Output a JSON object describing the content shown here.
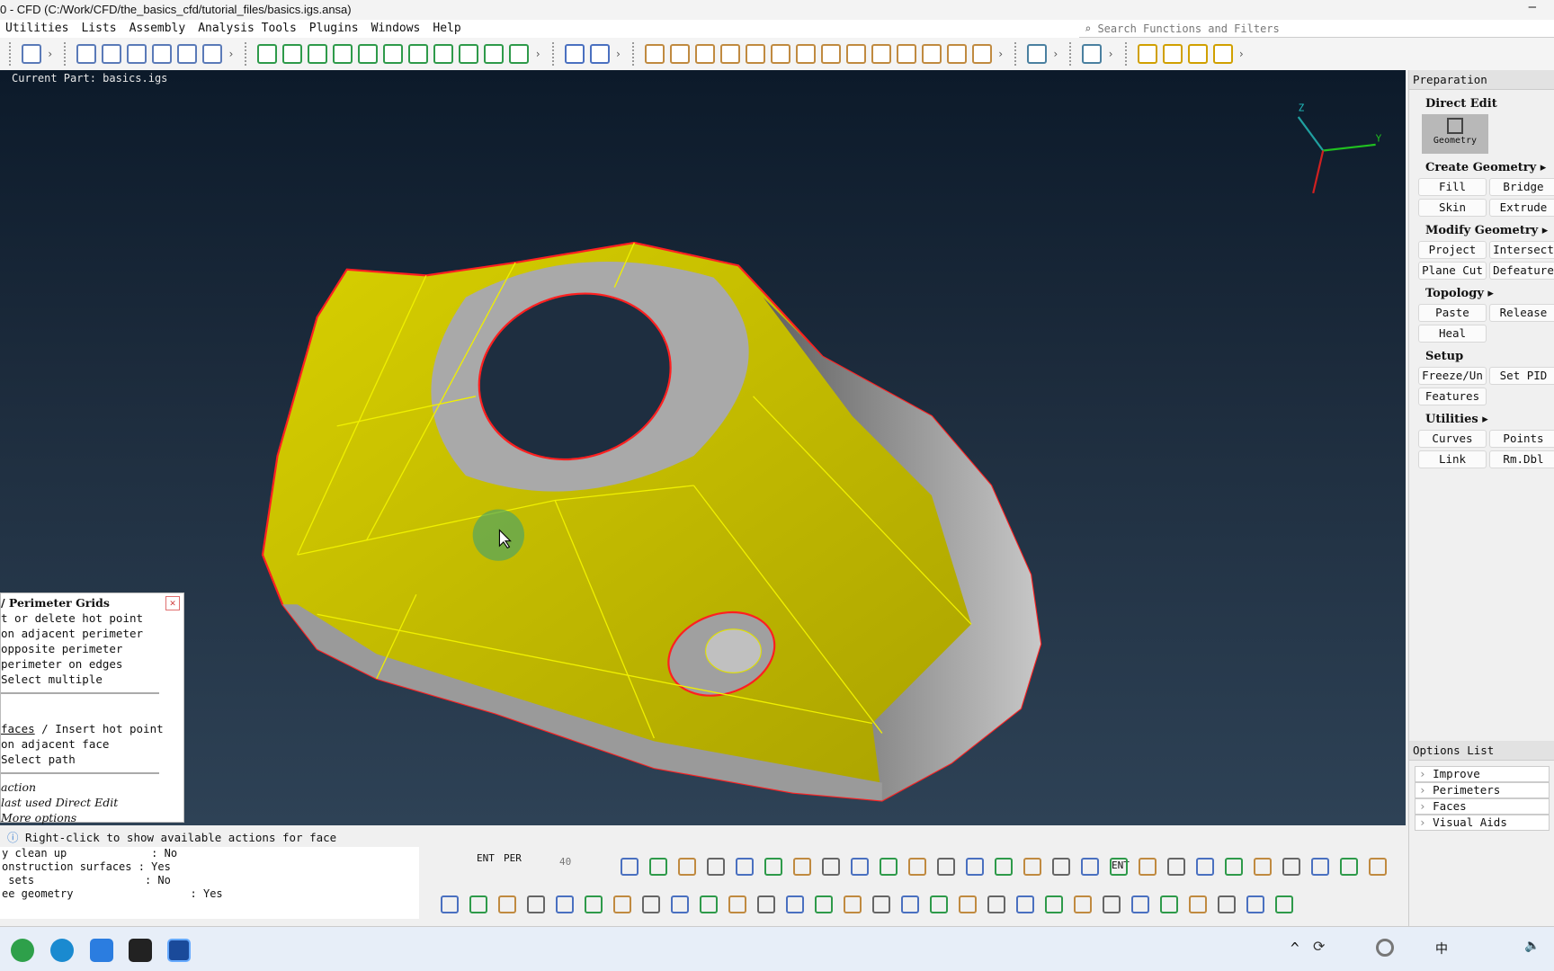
{
  "window": {
    "title": "0 - CFD (C:/Work/CFD/the_basics_cfd/tutorial_files/basics.igs.ansa)",
    "minimize": "–"
  },
  "menu": [
    "Utilities",
    "Lists",
    "Assembly",
    "Analysis Tools",
    "Plugins",
    "Windows",
    "Help"
  ],
  "search": {
    "placeholder": "Search Functions and Filters",
    "icon": "search-icon"
  },
  "viewport": {
    "current_part": "Current Part: basics.igs",
    "axis": {
      "z": "Z",
      "y": "Y"
    },
    "background": "#1c2b3c",
    "surface_color": "#c8c000",
    "edge_color": "#ff2020"
  },
  "popup": {
    "title": "/ Perimeter Grids",
    "lines": [
      "t or delete hot point",
      "on adjacent perimeter",
      " opposite perimeter",
      " perimeter on edges",
      "Select multiple"
    ],
    "faces_link": " faces",
    "faces_rest": " / Insert hot point",
    "lines2": [
      "on adjacent face",
      "Select path"
    ],
    "italic": [
      "action",
      " last used Direct Edit",
      " More options"
    ],
    "close": "✕"
  },
  "status": {
    "message": "Right-click to show available actions for face"
  },
  "console": [
    "y clean up             : No",
    "onstruction surfaces : Yes",
    " sets                 : No",
    "ee geometry                  : Yes"
  ],
  "bottom_toolbar": {
    "ent": "ENT",
    "per": "PER",
    "angle": "40",
    "ent2": "ENT"
  },
  "panel": {
    "header": "Preparation",
    "direct_edit": "Direct Edit",
    "geometry": "Geometry",
    "sections": [
      {
        "title": "Create Geometry ▸",
        "buttons": [
          "Fill",
          "Bridge",
          "Skin",
          "Extrude"
        ]
      },
      {
        "title": "Modify Geometry ▸",
        "buttons": [
          "Project",
          "Intersect",
          "Plane Cut",
          "Defeature"
        ]
      },
      {
        "title": "Topology ▸",
        "buttons": [
          "Paste",
          "Release",
          "Heal"
        ]
      },
      {
        "title": "Setup",
        "buttons": [
          "Freeze/Un",
          "Set PID",
          "Features"
        ]
      },
      {
        "title": "Utilities ▸",
        "buttons": [
          "Curves",
          "Points",
          "Link",
          "Rm.Dbl"
        ]
      }
    ],
    "options_header": "Options List",
    "options": [
      "Improve",
      "Perimeters",
      "Faces",
      "Visual Aids"
    ]
  },
  "tray": {
    "ime": "中"
  }
}
